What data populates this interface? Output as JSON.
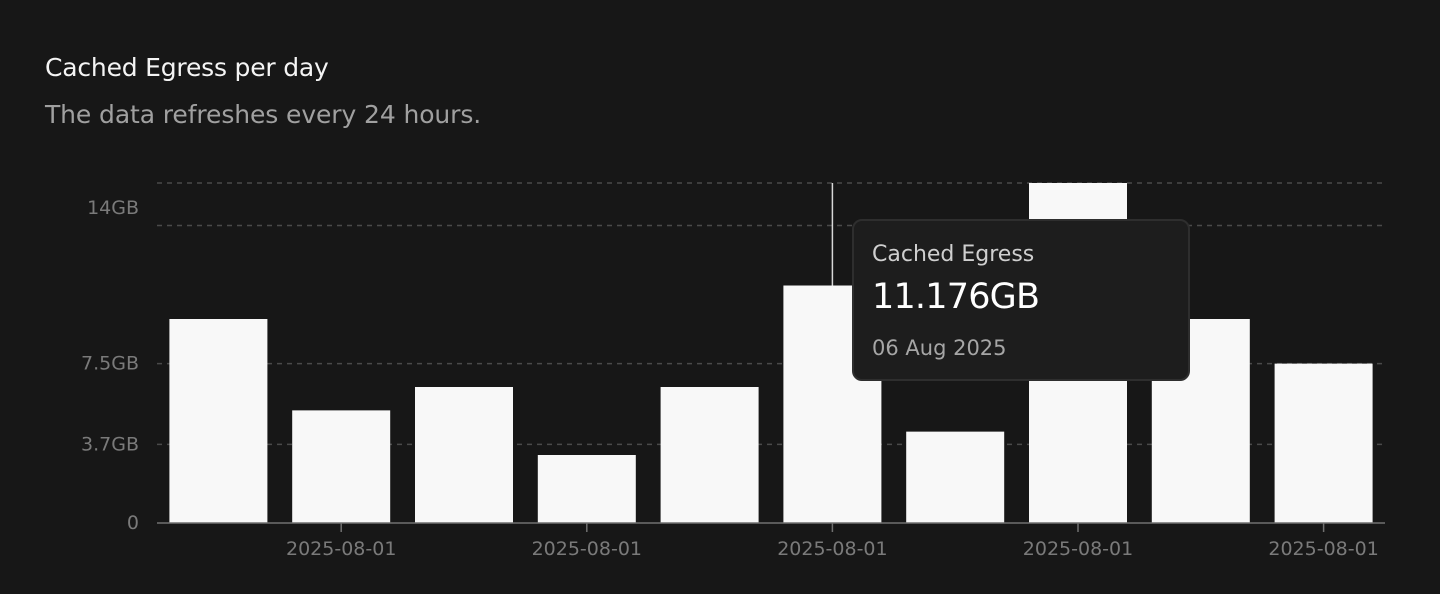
{
  "header": {
    "title": "Cached Egress per day",
    "subtitle": "The data refreshes every 24 hours."
  },
  "chart_data": {
    "type": "bar",
    "title": "Cached Egress per day",
    "subtitle": "The data refreshes every 24 hours.",
    "categories": [
      "",
      "2025-08-01",
      "",
      "2025-08-01",
      "",
      "2025-08-01",
      "",
      "2025-08-01",
      "",
      "2025-08-01"
    ],
    "series": [
      {
        "name": "Cached Egress",
        "values": [
          9.6,
          5.3,
          6.4,
          3.2,
          6.4,
          11.176,
          4.3,
          16.0,
          9.6,
          7.5
        ]
      }
    ],
    "y_ticks": [
      {
        "value": 0,
        "label": "0"
      },
      {
        "value": 3.7,
        "label": "3.7GB"
      },
      {
        "value": 7.5,
        "label": "7.5GB"
      },
      {
        "value": 14,
        "label": "14GB"
      }
    ],
    "ylim": [
      0,
      16
    ],
    "grid": true,
    "unit": "GB",
    "colors": {
      "bar": "#f8f8f8",
      "grid": "#4a4a4a",
      "axis": "#707070",
      "tick_label": "#7a7a7a",
      "cursor": "#d8d8d8"
    },
    "hover_index": 5
  },
  "tooltip": {
    "label": "Cached Egress",
    "value": "11.176GB",
    "date": "06 Aug 2025"
  }
}
